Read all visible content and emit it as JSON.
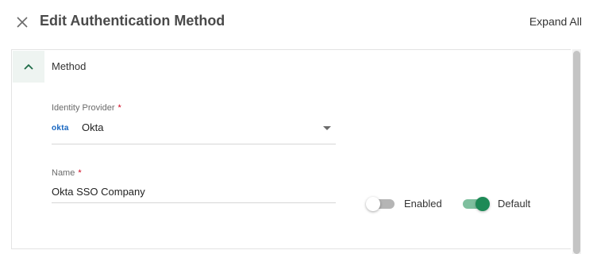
{
  "header": {
    "title": "Edit Authentication Method",
    "expand_all": "Expand All",
    "close_icon": "close-icon"
  },
  "section": {
    "title": "Method",
    "expanded": true,
    "toggle_icon": "chevron-up-icon"
  },
  "identity_provider": {
    "label": "Identity Provider",
    "required_mark": "*",
    "logo_text": "okta",
    "value": "Okta"
  },
  "name": {
    "label": "Name",
    "required_mark": "*",
    "value": "Okta SSO Company"
  },
  "toggles": {
    "enabled": {
      "label": "Enabled",
      "state": false
    },
    "default": {
      "label": "Default",
      "state": true
    }
  },
  "colors": {
    "accent": "#1e8a57",
    "accent_light": "#7ebf9e",
    "required": "#d0021b",
    "section_header_bg": "#eef4f1"
  }
}
